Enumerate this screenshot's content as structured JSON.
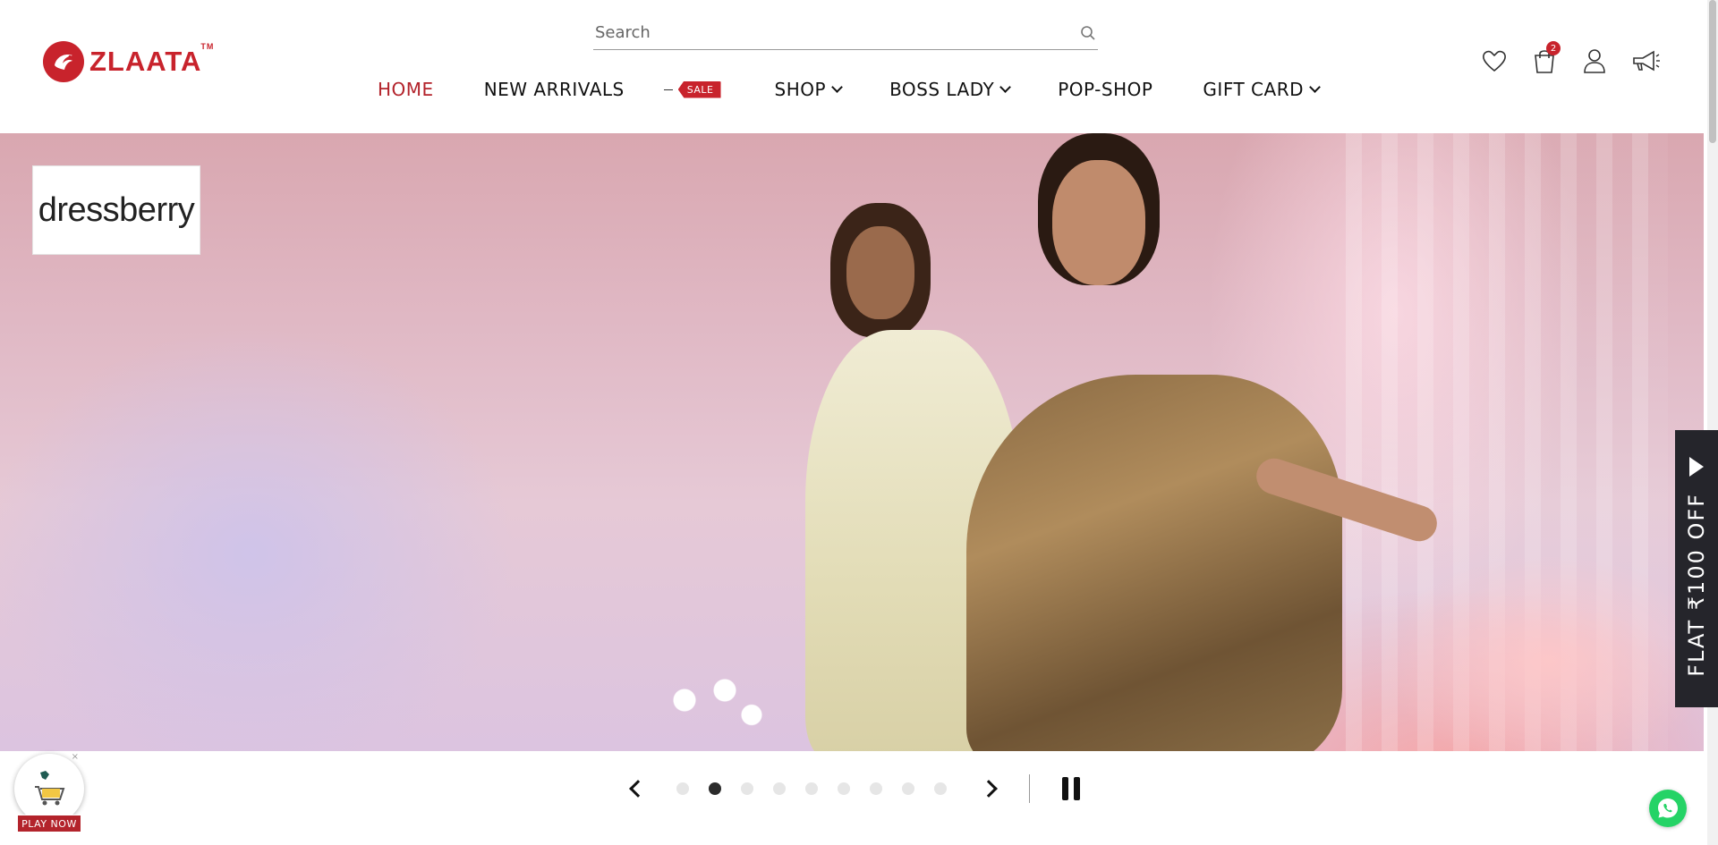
{
  "brand": {
    "name": "ZLAATA",
    "trademark": "TM",
    "color": "#c8232c"
  },
  "search": {
    "placeholder": "Search"
  },
  "nav": {
    "items": [
      {
        "label": "HOME",
        "active": true
      },
      {
        "label": "NEW ARRIVALS"
      },
      {
        "label": "SALE",
        "type": "tag"
      },
      {
        "label": "SHOP",
        "dropdown": true
      },
      {
        "label": "BOSS LADY",
        "dropdown": true
      },
      {
        "label": "POP-SHOP"
      },
      {
        "label": "GIFT CARD",
        "dropdown": true
      }
    ]
  },
  "header_icons": {
    "wishlist": "heart-icon",
    "cart": "shopping-bag-icon",
    "cart_count": "2",
    "account": "user-icon",
    "announcements": "megaphone-icon"
  },
  "hero": {
    "brand_badge": "dressberry",
    "slide_count": 9,
    "active_slide": 2
  },
  "offer_tab": {
    "label": "FLAT ₹100 OFF"
  },
  "game_widget": {
    "button_label": "PLAY NOW",
    "close": "×"
  },
  "colors": {
    "accent": "#b3232b",
    "offer_tab_bg": "#25252b",
    "whatsapp": "#25d366"
  }
}
